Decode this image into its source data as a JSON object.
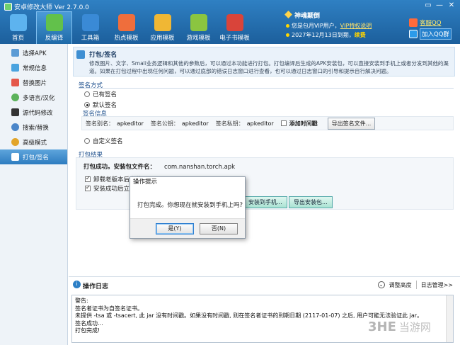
{
  "app": {
    "title": "安卓修改大师 Ver 2.7.0.0"
  },
  "window_controls": {
    "restore": "▭",
    "minimize": "—",
    "close": "✕"
  },
  "nav": [
    {
      "label": "首页",
      "icon": "home-icon",
      "color": "#5db3ef"
    },
    {
      "label": "反编译",
      "icon": "decompile-icon",
      "color": "#62c14b"
    },
    {
      "label": "工具箱",
      "icon": "toolbox-icon",
      "color": "#3a8ad6"
    },
    {
      "label": "热点模板",
      "icon": "hot-template-icon",
      "color": "#ef6e3c"
    },
    {
      "label": "应用模板",
      "icon": "app-template-icon",
      "color": "#f0b734"
    },
    {
      "label": "游戏模板",
      "icon": "game-template-icon",
      "color": "#8bc540"
    },
    {
      "label": "电子书模板",
      "icon": "ebook-template-icon",
      "color": "#d9443a"
    }
  ],
  "vip": {
    "title": "神魂颠倒",
    "line1_prefix": "您是包月VIP用户，",
    "line1_link": "VIP特权说明",
    "line2_prefix": "2027年12月13日到期，",
    "line2_renew": "续费"
  },
  "qq": {
    "service": "客服QQ",
    "group": "加入QQ群"
  },
  "sidebar": [
    {
      "label": "选择APK",
      "color": "#5b9bd5"
    },
    {
      "label": "常规信息",
      "color": "#4aa3df"
    },
    {
      "label": "替换图片",
      "color": "#e4574a"
    },
    {
      "label": "多语言/汉化",
      "color": "#5bb25b"
    },
    {
      "label": "源代码修改",
      "color": "#333333"
    },
    {
      "label": "搜索/替换",
      "color": "#4b86c9"
    },
    {
      "label": "高级模式",
      "color": "#e2a52b"
    },
    {
      "label": "打包/签名",
      "color": "#ffffff"
    }
  ],
  "header": {
    "title": "打包/签名",
    "desc": "修改图片、文字、Smali业务逻辑和其他的参数后，可以通过本功能进行打包。打包编译后生成的APK安装包，可以直接安装到手机上或者分发到其他的渠道。如果在打包过程中出现任何问题，可以通过底部的错误日志窗口进行查看，也可以通过日志窗口的引导和提示自行解决问题。"
  },
  "sign": {
    "group_title": "签名方式",
    "opt_existing": "已有签名",
    "opt_default": "默认签名",
    "info_title": "签名信息",
    "alias_label": "签名别名：",
    "alias_value": "apkeditor",
    "pub_label": "签名公钥：",
    "pub_value": "apkeditor",
    "priv_label": "签名私钥：",
    "priv_value": "apkeditor",
    "timestamp_label": "添加时间戳",
    "export_button": "导出签名文件...",
    "opt_custom": "自定义签名"
  },
  "result": {
    "group_title": "打包结果",
    "success_label": "打包成功。安装包文件名：",
    "package_name": "com.nanshan.torch.apk",
    "chk_uninstall": "卸载老版本后安装",
    "chk_launch": "安装成功后立刻",
    "install_button": "安装到手机...",
    "export_button": "导出安装包..."
  },
  "dialog": {
    "title": "操作提示",
    "message": "打包完成。你想现在就安装到手机上吗?",
    "yes": "是(Y)",
    "no": "否(N)"
  },
  "log": {
    "title": "操作日志",
    "adjust": "调整高度",
    "manage": "日志管理>>",
    "lines": [
      "警告:",
      "签名者证书为自签名证书。",
      "未提供 -tsa 或 -tsacert, 此 jar 没有时间戳。如果没有时间戳, 则在签名者证书的到期日期 (2117-01-07) 之后, 用户可能无法验证此 jar。",
      "签名成功...",
      "打包完成!"
    ]
  },
  "watermark": {
    "logo": "3HE",
    "text": "当游网"
  }
}
